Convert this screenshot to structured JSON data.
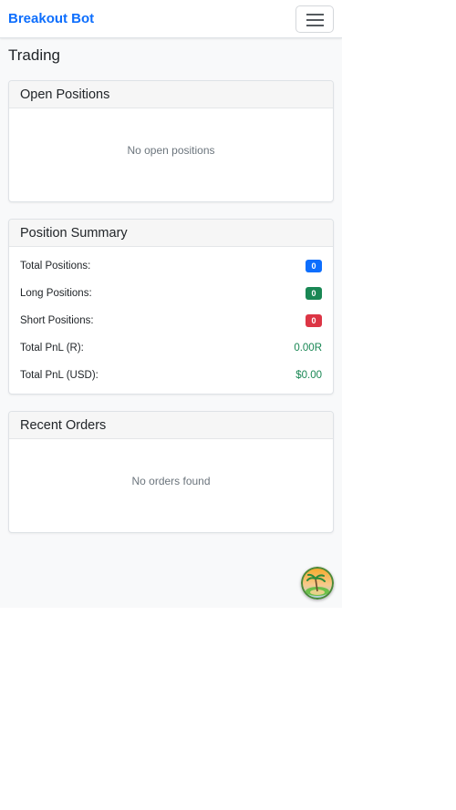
{
  "navbar": {
    "brand": "Breakout Bot",
    "toggler_icon": "hamburger-menu-icon"
  },
  "page": {
    "title": "Trading"
  },
  "open_positions": {
    "header": "Open Positions",
    "empty_text": "No open positions"
  },
  "position_summary": {
    "header": "Position Summary",
    "rows": [
      {
        "label": "Total Positions:",
        "value": "0",
        "color": "#0d6efd"
      },
      {
        "label": "Long Positions:",
        "value": "0",
        "color": "#198754"
      },
      {
        "label": "Short Positions:",
        "value": "0",
        "color": "#dc3545"
      },
      {
        "label": "Total PnL (R):",
        "value": "0.00R",
        "color": "#198754"
      },
      {
        "label": "Total PnL (USD):",
        "value": "$0.00",
        "color": "#198754"
      }
    ]
  },
  "recent_orders": {
    "header": "Recent Orders",
    "empty_text": "No orders found"
  },
  "fab": {
    "icon": "island-sunset-avatar-icon"
  },
  "colors": {
    "brand": "#0d6efd",
    "page_background": "#f8f9fa",
    "success": "#198754",
    "danger": "#dc3545",
    "primary": "#0d6efd"
  }
}
